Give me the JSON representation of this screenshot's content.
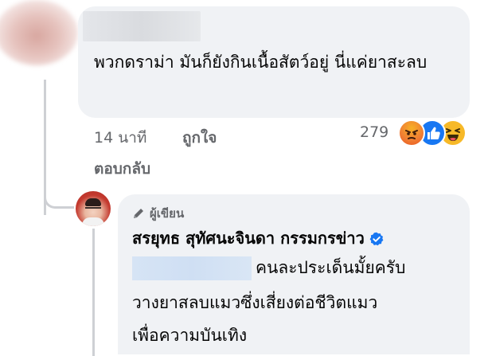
{
  "comment": {
    "text": "พวกดราม่า มันก็ยังกินเนื้อสัตว์อยู่ นี่แค่ยาสะลบ",
    "time": "14 นาที",
    "like_label": "ถูกใจ",
    "reply_label": "ตอบกลับ",
    "reaction_count": "279",
    "reactions": [
      "angry-icon",
      "like-icon",
      "haha-icon"
    ]
  },
  "reply": {
    "author_badge": "ผู้เขียน",
    "author_name": "สรยุทธ สุทัศนะจินดา กรรมกรข่าว",
    "line1": "คนละประเด็นมั้ยครับ",
    "line2": "วางยาสลบแมวซึ่งเสี่ยงต่อชีวิตแมว",
    "line3": "เพื่อความบันเทิง"
  },
  "colors": {
    "bubble_bg": "#f0f2f5",
    "meta_text": "#65676b",
    "verified": "#1877f2"
  }
}
